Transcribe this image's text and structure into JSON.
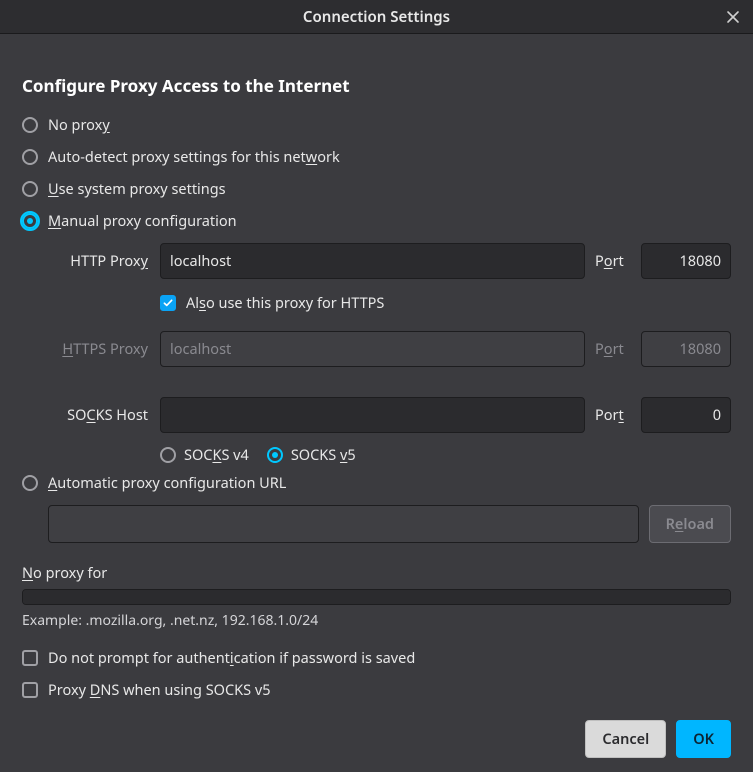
{
  "titlebar": {
    "title": "Connection Settings"
  },
  "section_heading": "Configure Proxy Access to the Internet",
  "proxy_mode": {
    "no_proxy": {
      "pre": "No prox",
      "u": "y",
      "post": ""
    },
    "auto_detect": {
      "pre": "Auto-detect proxy settings for this net",
      "u": "w",
      "post": "ork"
    },
    "use_system": {
      "pre": "",
      "u": "U",
      "post": "se system proxy settings"
    },
    "manual": {
      "pre": "",
      "u": "M",
      "post": "anual proxy configuration"
    },
    "auto_url": {
      "pre": "",
      "u": "A",
      "post": "utomatic proxy configuration URL"
    }
  },
  "http": {
    "label_pre": "HTTP Prox",
    "label_u": "y",
    "label_post": "",
    "host": "localhost",
    "port_label_pre": "P",
    "port_label_u": "o",
    "port_label_post": "rt",
    "port": "18080"
  },
  "also_https": {
    "pre": "Al",
    "u": "s",
    "post": "o use this proxy for HTTPS"
  },
  "https": {
    "label_pre": "",
    "label_u": "H",
    "label_post": "TTPS Proxy",
    "host": "localhost",
    "port_label_pre": "P",
    "port_label_u": "o",
    "port_label_post": "rt",
    "port": "18080"
  },
  "socks": {
    "label_pre": "SO",
    "label_u": "C",
    "label_post": "KS Host",
    "host": "",
    "port_label_pre": "Por",
    "port_label_u": "t",
    "port_label_post": "",
    "port": "0",
    "v4": {
      "pre": "SOC",
      "u": "K",
      "post": "S v4"
    },
    "v5": {
      "pre": "SOCKS ",
      "u": "v",
      "post": "5"
    }
  },
  "pac": {
    "url": "",
    "reload_pre": "R",
    "reload_u": "e",
    "reload_post": "load"
  },
  "noproxy": {
    "label_pre": "",
    "label_u": "N",
    "label_post": "o proxy for",
    "value": "",
    "example": "Example: .mozilla.org, .net.nz, 192.168.1.0/24"
  },
  "opts": {
    "no_prompt": {
      "pre": "Do not prompt for authent",
      "u": "i",
      "post": "cation if password is saved"
    },
    "proxy_dns": {
      "pre": "Proxy ",
      "u": "D",
      "post": "NS when using SOCKS v5"
    }
  },
  "buttons": {
    "cancel": "Cancel",
    "ok": "OK"
  }
}
